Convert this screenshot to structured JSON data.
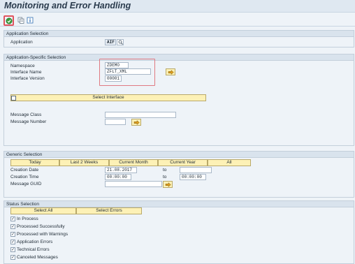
{
  "header": {
    "title": "Monitoring and Error Handling"
  },
  "toolbar": {
    "icons": [
      "execute-icon",
      "get-variant-icon",
      "info-icon"
    ]
  },
  "application_selection": {
    "title": "Application Selection",
    "application_label": "Application",
    "application_value": "AIF"
  },
  "app_specific": {
    "title": "Application-Specific Selection",
    "namespace_label": "Namespace",
    "namespace_value": "ZDEMO",
    "interface_name_label": "Interface Name",
    "interface_name_value": "ZFLT_XML",
    "interface_version_label": "Interface Version",
    "interface_version_value": "00001",
    "select_interface_label": "Select Interface",
    "message_class_label": "Message Class",
    "message_class_value": "",
    "message_number_label": "Message Number",
    "message_number_value": ""
  },
  "generic_selection": {
    "title": "Generic Selection",
    "buttons": [
      "Today",
      "Last 2 Weeks",
      "Current Month",
      "Current Year",
      "All"
    ],
    "creation_date_label": "Creation Date",
    "creation_date_from": "21.08.2017",
    "creation_date_to": "",
    "to_label": "to",
    "creation_time_label": "Creation Time",
    "creation_time_from": "00:00:00",
    "creation_time_to": "00:00:00",
    "message_guid_label": "Message GUID",
    "message_guid_value": ""
  },
  "status_selection": {
    "title": "Status Selection",
    "select_all_label": "Select All",
    "select_errors_label": "Select Errors",
    "items": [
      {
        "label": "In Process",
        "checked": true
      },
      {
        "label": "Processed Successfully",
        "checked": true
      },
      {
        "label": "Processed with Warnings",
        "checked": true
      },
      {
        "label": "Application Errors",
        "checked": true
      },
      {
        "label": "Technical Errors",
        "checked": true
      },
      {
        "label": "Canceled Messages",
        "checked": true
      }
    ]
  },
  "colors": {
    "background": "#eef3f8",
    "button_fill": "#fdf1b6",
    "highlight_red": "#e0555f",
    "header_band": "#d9e3ed"
  }
}
